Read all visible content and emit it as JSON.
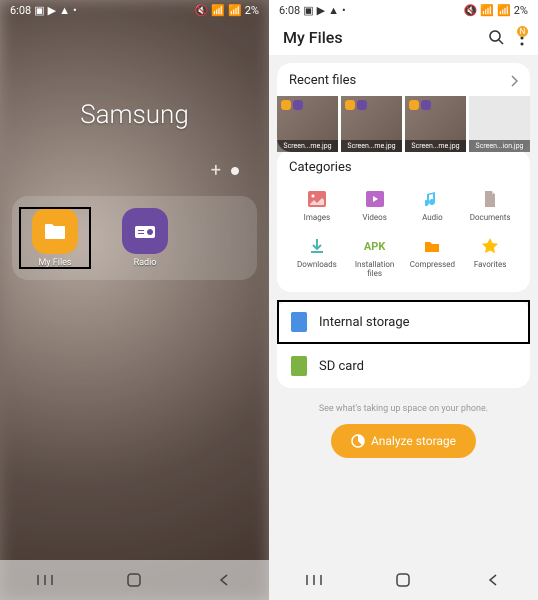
{
  "status": {
    "time": "6:08",
    "battery": "2%"
  },
  "left": {
    "folder_title": "Samsung",
    "apps": [
      {
        "label": "My Files"
      },
      {
        "label": "Radio"
      }
    ]
  },
  "right": {
    "header_title": "My Files",
    "badge": "N",
    "recent": {
      "title": "Recent files",
      "thumbs": [
        {
          "label": "Screen...me.jpg"
        },
        {
          "label": "Screen...me.jpg"
        },
        {
          "label": "Screen...me.jpg"
        },
        {
          "label": "Screen...ion.jpg"
        }
      ]
    },
    "categories": {
      "title": "Categories",
      "items": [
        {
          "label": "Images",
          "color": "#e57373"
        },
        {
          "label": "Videos",
          "color": "#ba68c8"
        },
        {
          "label": "Audio",
          "color": "#4fc3f7"
        },
        {
          "label": "Documents",
          "color": "#bcaaa4"
        },
        {
          "label": "Downloads",
          "color": "#4db6ac"
        },
        {
          "label": "Installation files",
          "color": "#7cb342"
        },
        {
          "label": "Compressed",
          "color": "#ff9800"
        },
        {
          "label": "Favorites",
          "color": "#ffc107"
        }
      ]
    },
    "storage": [
      {
        "label": "Internal storage"
      },
      {
        "label": "SD card"
      }
    ],
    "analyze": {
      "hint": "See what's taking up space on your phone.",
      "button": "Analyze storage"
    }
  }
}
